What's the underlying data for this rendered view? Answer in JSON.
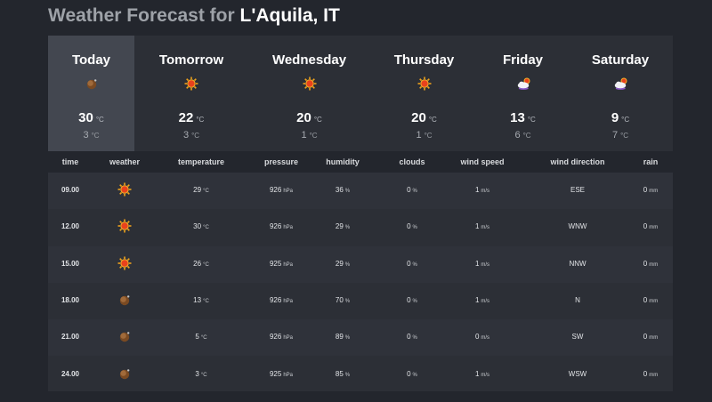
{
  "header": {
    "prefix": "Weather Forecast for",
    "city": "L'Aquila, IT"
  },
  "units": {
    "temp": "°C",
    "pressure": "hPa",
    "humidity": "%",
    "clouds": "%",
    "wind": "m/s",
    "rain": "mm"
  },
  "days": [
    {
      "name": "Today",
      "icon": "moon-icon",
      "high": "30",
      "low": "3"
    },
    {
      "name": "Tomorrow",
      "icon": "sun-icon",
      "high": "22",
      "low": "3"
    },
    {
      "name": "Wednesday",
      "icon": "sun-icon",
      "high": "20",
      "low": "1"
    },
    {
      "name": "Thursday",
      "icon": "sun-icon",
      "high": "20",
      "low": "1"
    },
    {
      "name": "Friday",
      "icon": "cloud-sun-icon",
      "high": "13",
      "low": "6"
    },
    {
      "name": "Saturday",
      "icon": "cloud-sun-icon",
      "high": "9",
      "low": "7"
    }
  ],
  "table": {
    "headers": [
      "time",
      "weather",
      "temperature",
      "pressure",
      "humidity",
      "clouds",
      "wind speed",
      "wind direction",
      "rain"
    ],
    "rows": [
      {
        "time": "09.00",
        "icon": "sun-icon",
        "temp": "29",
        "pressure": "926",
        "humidity": "36",
        "clouds": "0",
        "wind": "1",
        "dir": "ESE",
        "rain": "0"
      },
      {
        "time": "12.00",
        "icon": "sun-icon",
        "temp": "30",
        "pressure": "926",
        "humidity": "29",
        "clouds": "0",
        "wind": "1",
        "dir": "WNW",
        "rain": "0"
      },
      {
        "time": "15.00",
        "icon": "sun-icon",
        "temp": "26",
        "pressure": "925",
        "humidity": "29",
        "clouds": "0",
        "wind": "1",
        "dir": "NNW",
        "rain": "0"
      },
      {
        "time": "18.00",
        "icon": "moon-icon",
        "temp": "13",
        "pressure": "926",
        "humidity": "70",
        "clouds": "0",
        "wind": "1",
        "dir": "N",
        "rain": "0"
      },
      {
        "time": "21.00",
        "icon": "moon-icon",
        "temp": "5",
        "pressure": "926",
        "humidity": "89",
        "clouds": "0",
        "wind": "0",
        "dir": "SW",
        "rain": "0"
      },
      {
        "time": "24.00",
        "icon": "moon-icon",
        "temp": "3",
        "pressure": "925",
        "humidity": "85",
        "clouds": "0",
        "wind": "1",
        "dir": "WSW",
        "rain": "0"
      }
    ]
  }
}
